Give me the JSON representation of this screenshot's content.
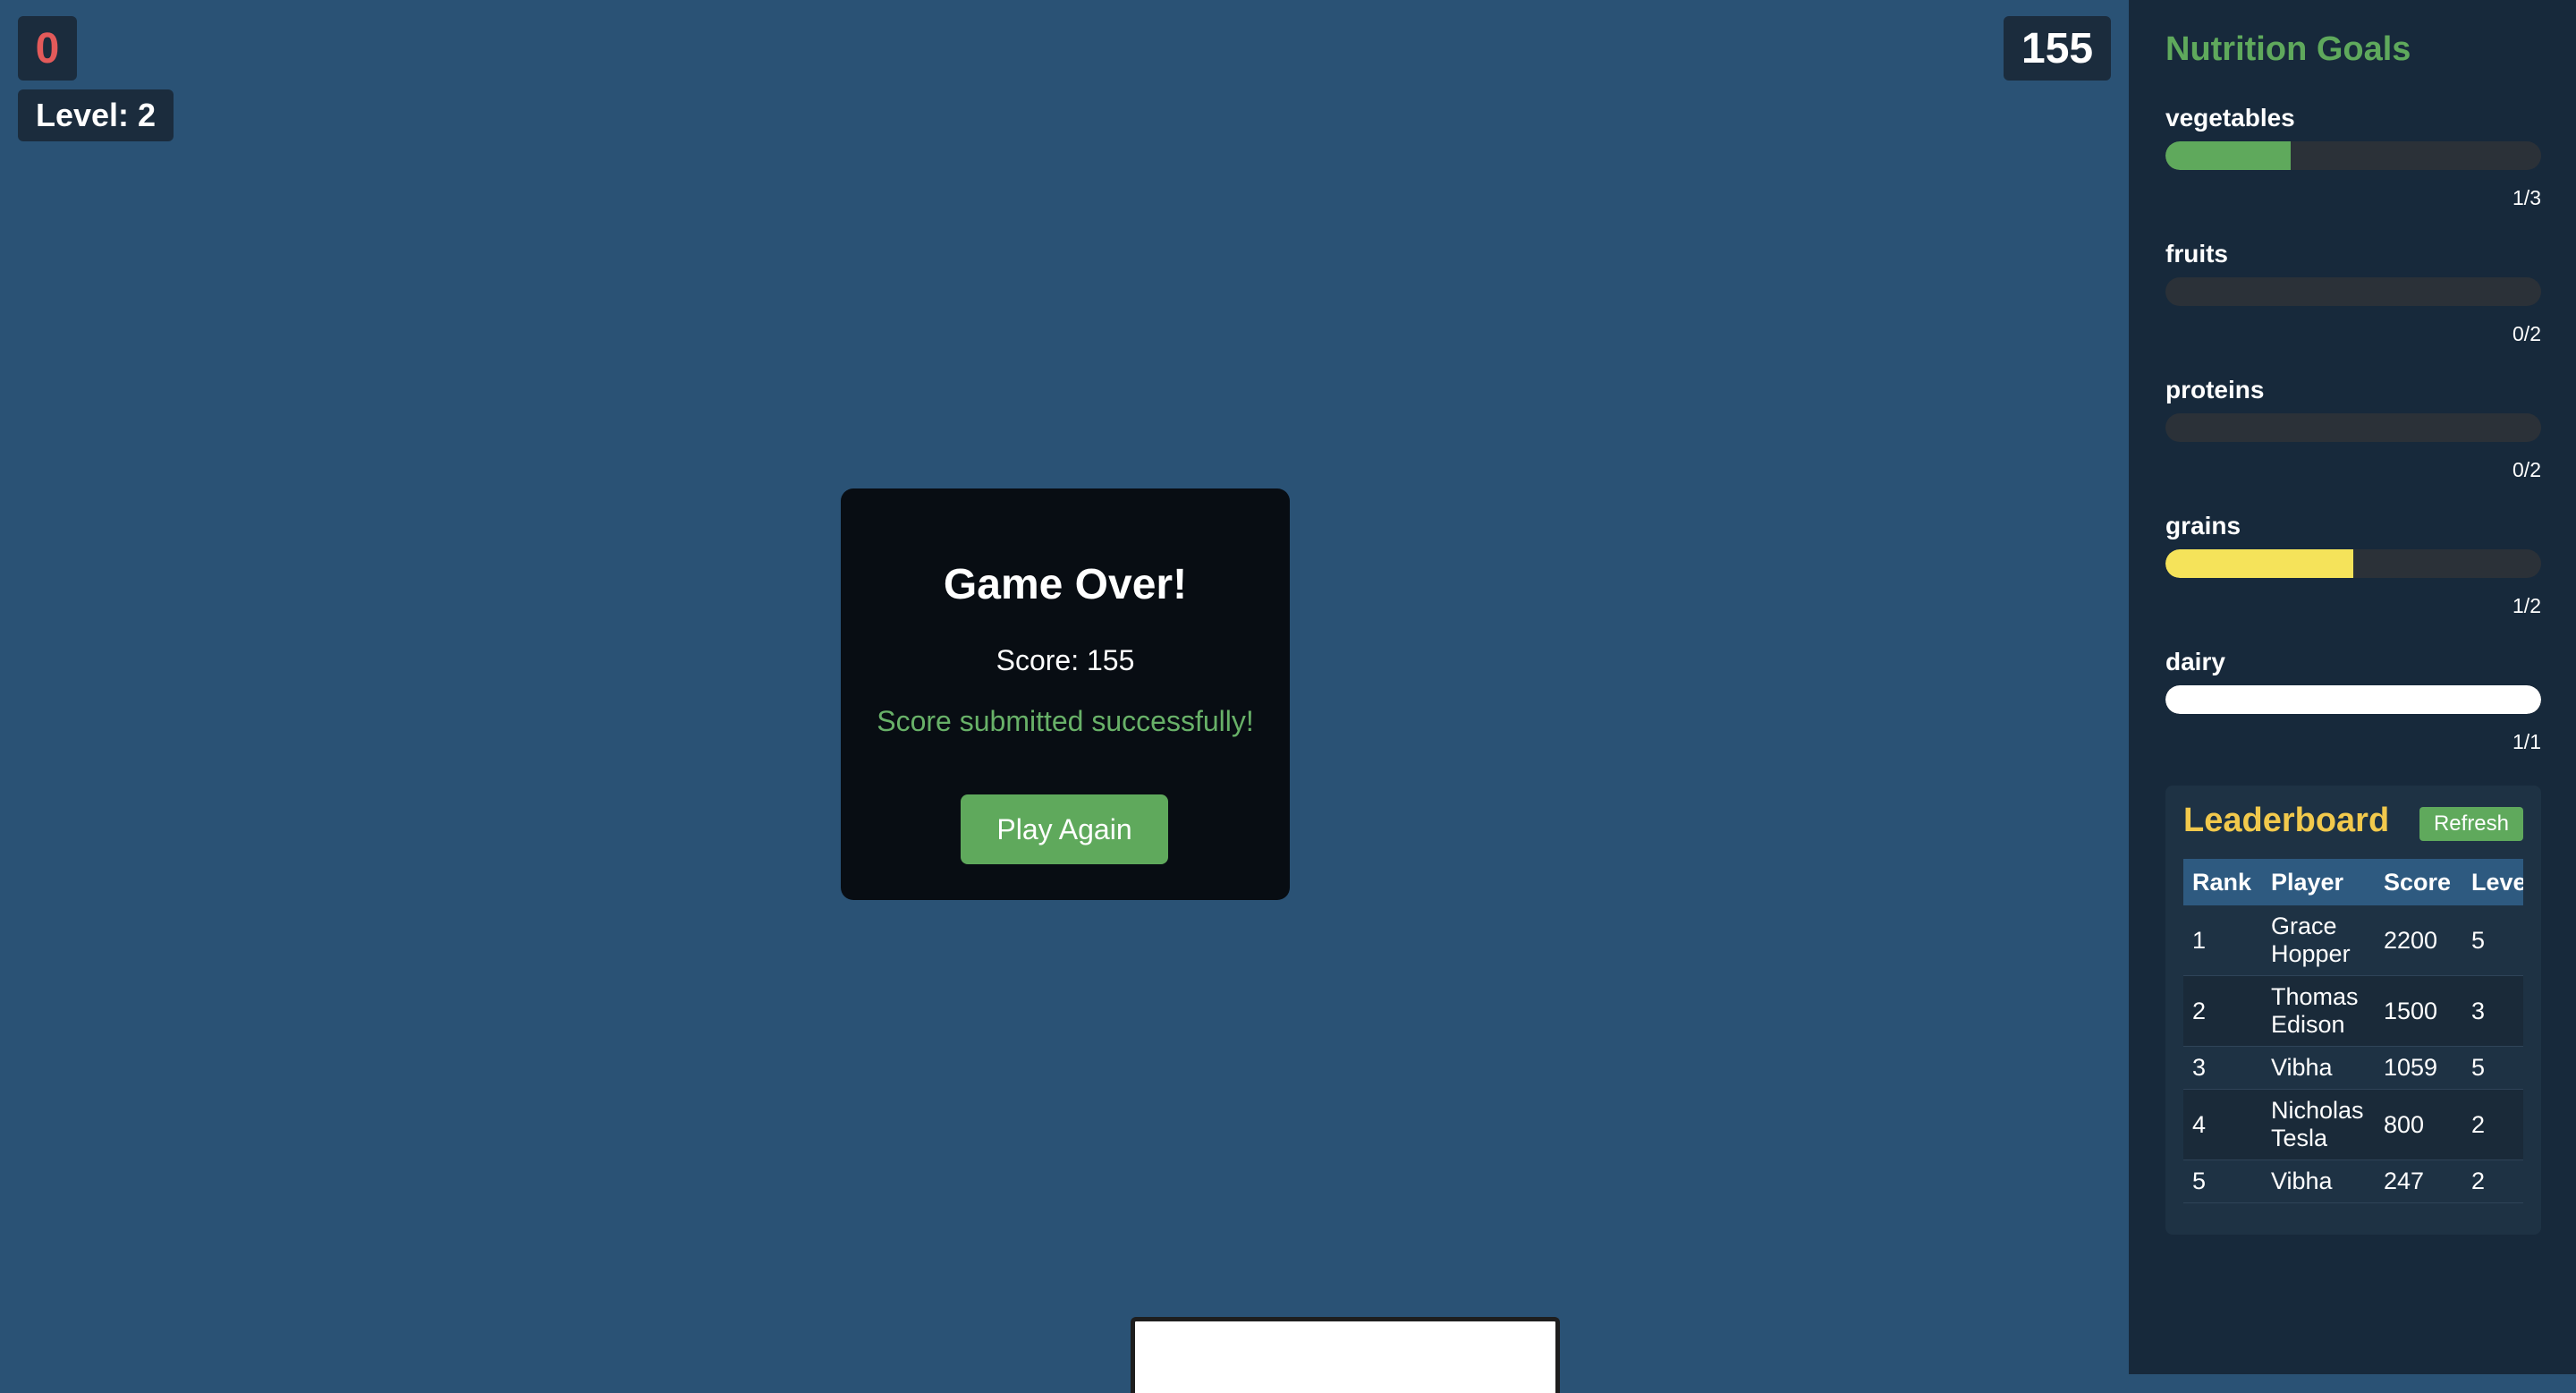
{
  "hud": {
    "lives": "0",
    "level_label": "Level: 2",
    "score": "155"
  },
  "modal": {
    "title": "Game Over!",
    "score_text": "Score: 155",
    "message": "Score submitted successfully!",
    "play_again_label": "Play Again"
  },
  "sidebar": {
    "goals_title": "Nutrition Goals",
    "goals": [
      {
        "name": "vegetables",
        "count": "1/3",
        "progress": 0.333,
        "color": "#5fa95c"
      },
      {
        "name": "fruits",
        "count": "0/2",
        "progress": 0,
        "color": "#e35a5a"
      },
      {
        "name": "proteins",
        "count": "0/2",
        "progress": 0,
        "color": "#c08040"
      },
      {
        "name": "grains",
        "count": "1/2",
        "progress": 0.5,
        "color": "#f5e35a"
      },
      {
        "name": "dairy",
        "count": "1/1",
        "progress": 1,
        "color": "#ffffff"
      }
    ],
    "leaderboard": {
      "title": "Leaderboard",
      "refresh_label": "Refresh",
      "columns": [
        "Rank",
        "Player",
        "Score",
        "Level"
      ],
      "rows": [
        {
          "rank": "1",
          "player": "Grace Hopper",
          "score": "2200",
          "level": "5"
        },
        {
          "rank": "2",
          "player": "Thomas Edison",
          "score": "1500",
          "level": "3"
        },
        {
          "rank": "3",
          "player": "Vibha",
          "score": "1059",
          "level": "5"
        },
        {
          "rank": "4",
          "player": "Nicholas Tesla",
          "score": "800",
          "level": "2"
        },
        {
          "rank": "5",
          "player": "Vibha",
          "score": "247",
          "level": "2"
        }
      ]
    }
  },
  "colors": {
    "background": "#2a5275",
    "sidebar": "#17293b",
    "accent_green": "#5fa95c",
    "leaderboard_title": "#f2c94c",
    "lives": "#e35a5a"
  }
}
